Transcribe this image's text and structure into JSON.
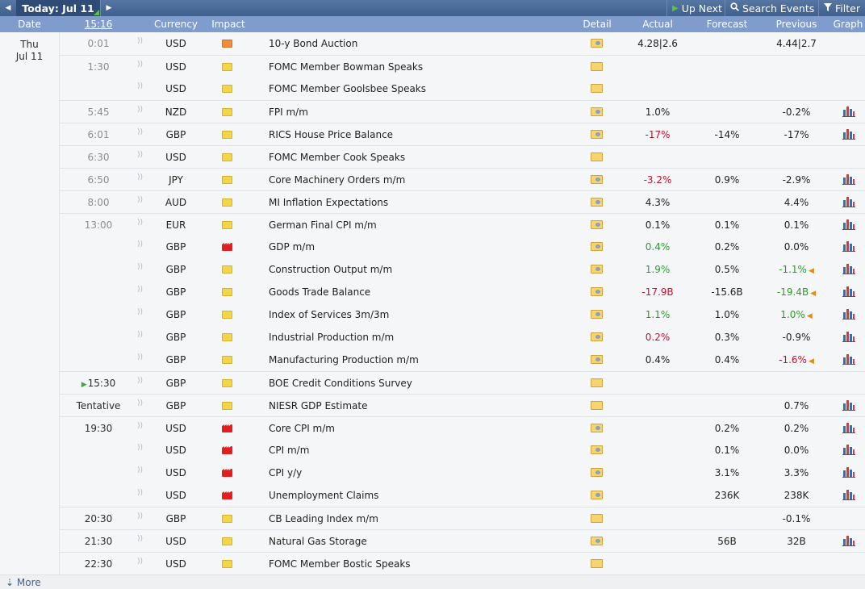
{
  "topbar": {
    "today_label": "Today: Jul 11",
    "up_next": "Up Next",
    "search": "Search Events",
    "filter": "Filter"
  },
  "header": {
    "date": "Date",
    "time": "15:16",
    "currency": "Currency",
    "impact": "Impact",
    "detail": "Detail",
    "actual": "Actual",
    "forecast": "Forecast",
    "previous": "Previous",
    "graph": "Graph"
  },
  "date_cell": {
    "weekday": "Thu",
    "date": "Jul 11"
  },
  "colors": {
    "header_bg": "#7f9ccc",
    "topbar_bg": "#3f5f8e",
    "negative": "#c8102e",
    "positive": "#2e9a2e"
  },
  "events": [
    {
      "time": "0:01",
      "currency": "USD",
      "impact": "orange",
      "name": "10-y Bond Auction",
      "actual": "4.28|2.6",
      "forecast": "",
      "previous": "4.44|2.7",
      "graph": false
    },
    {
      "time": "1:30",
      "currency": "USD",
      "impact": "yellow",
      "name": "FOMC Member Bowman Speaks",
      "actual": "",
      "forecast": "",
      "previous": "",
      "graph": false
    },
    {
      "time": "",
      "currency": "USD",
      "impact": "yellow",
      "name": "FOMC Member Goolsbee Speaks",
      "actual": "",
      "forecast": "",
      "previous": "",
      "graph": false
    },
    {
      "time": "5:45",
      "currency": "NZD",
      "impact": "yellow",
      "name": "FPI m/m",
      "actual": "1.0%",
      "forecast": "",
      "previous": "-0.2%",
      "graph": true
    },
    {
      "time": "6:01",
      "currency": "GBP",
      "impact": "yellow",
      "name": "RICS House Price Balance",
      "actual": "-17%",
      "actual_class": "neg",
      "forecast": "-14%",
      "previous": "-17%",
      "graph": true
    },
    {
      "time": "6:30",
      "currency": "USD",
      "impact": "yellow",
      "name": "FOMC Member Cook Speaks",
      "actual": "",
      "forecast": "",
      "previous": "",
      "graph": false
    },
    {
      "time": "6:50",
      "currency": "JPY",
      "impact": "yellow",
      "name": "Core Machinery Orders m/m",
      "actual": "-3.2%",
      "actual_class": "neg",
      "forecast": "0.9%",
      "previous": "-2.9%",
      "graph": true
    },
    {
      "time": "8:00",
      "currency": "AUD",
      "impact": "yellow",
      "name": "MI Inflation Expectations",
      "actual": "4.3%",
      "forecast": "",
      "previous": "4.4%",
      "graph": true
    },
    {
      "time": "13:00",
      "currency": "EUR",
      "impact": "yellow",
      "name": "German Final CPI m/m",
      "actual": "0.1%",
      "forecast": "0.1%",
      "previous": "0.1%",
      "graph": true
    },
    {
      "time": "",
      "currency": "GBP",
      "impact": "red",
      "name": "GDP m/m",
      "actual": "0.4%",
      "actual_class": "pos",
      "forecast": "0.2%",
      "previous": "0.0%",
      "graph": true
    },
    {
      "time": "",
      "currency": "GBP",
      "impact": "yellow",
      "name": "Construction Output m/m",
      "actual": "1.9%",
      "actual_class": "pos",
      "forecast": "0.5%",
      "previous": "-1.1%",
      "previous_class": "pos",
      "revised": true,
      "graph": true
    },
    {
      "time": "",
      "currency": "GBP",
      "impact": "yellow",
      "name": "Goods Trade Balance",
      "actual": "-17.9B",
      "actual_class": "neg",
      "forecast": "-15.6B",
      "previous": "-19.4B",
      "previous_class": "pos",
      "revised": true,
      "graph": true
    },
    {
      "time": "",
      "currency": "GBP",
      "impact": "yellow",
      "name": "Index of Services 3m/3m",
      "actual": "1.1%",
      "actual_class": "pos",
      "forecast": "1.0%",
      "previous": "1.0%",
      "previous_class": "pos",
      "revised": true,
      "graph": true
    },
    {
      "time": "",
      "currency": "GBP",
      "impact": "yellow",
      "name": "Industrial Production m/m",
      "actual": "0.2%",
      "actual_class": "neg",
      "forecast": "0.3%",
      "previous": "-0.9%",
      "graph": true
    },
    {
      "time": "",
      "currency": "GBP",
      "impact": "yellow",
      "name": "Manufacturing Production m/m",
      "actual": "0.4%",
      "forecast": "0.4%",
      "previous": "-1.6%",
      "previous_class": "neg",
      "revised": true,
      "graph": true
    },
    {
      "time": "15:30",
      "currency": "GBP",
      "impact": "yellow",
      "name": "BOE Credit Conditions Survey",
      "actual": "",
      "forecast": "",
      "previous": "",
      "graph": false,
      "upnext": true
    },
    {
      "time": "Tentative",
      "currency": "GBP",
      "impact": "yellow",
      "name": "NIESR GDP Estimate",
      "actual": "",
      "forecast": "",
      "previous": "0.7%",
      "graph": true
    },
    {
      "time": "19:30",
      "currency": "USD",
      "impact": "red",
      "name": "Core CPI m/m",
      "actual": "",
      "forecast": "0.2%",
      "previous": "0.2%",
      "graph": true
    },
    {
      "time": "",
      "currency": "USD",
      "impact": "red",
      "name": "CPI m/m",
      "actual": "",
      "forecast": "0.1%",
      "previous": "0.0%",
      "graph": true
    },
    {
      "time": "",
      "currency": "USD",
      "impact": "red",
      "name": "CPI y/y",
      "actual": "",
      "forecast": "3.1%",
      "previous": "3.3%",
      "graph": true
    },
    {
      "time": "",
      "currency": "USD",
      "impact": "red",
      "name": "Unemployment Claims",
      "actual": "",
      "forecast": "236K",
      "previous": "238K",
      "graph": true
    },
    {
      "time": "20:30",
      "currency": "GBP",
      "impact": "yellow",
      "name": "CB Leading Index m/m",
      "actual": "",
      "forecast": "",
      "previous": "-0.1%",
      "graph": false
    },
    {
      "time": "21:30",
      "currency": "USD",
      "impact": "yellow",
      "name": "Natural Gas Storage",
      "actual": "",
      "forecast": "56B",
      "previous": "32B",
      "graph": true
    },
    {
      "time": "22:30",
      "currency": "USD",
      "impact": "yellow",
      "name": "FOMC Member Bostic Speaks",
      "actual": "",
      "forecast": "",
      "previous": "",
      "graph": false
    }
  ],
  "footer": {
    "more": "More"
  }
}
